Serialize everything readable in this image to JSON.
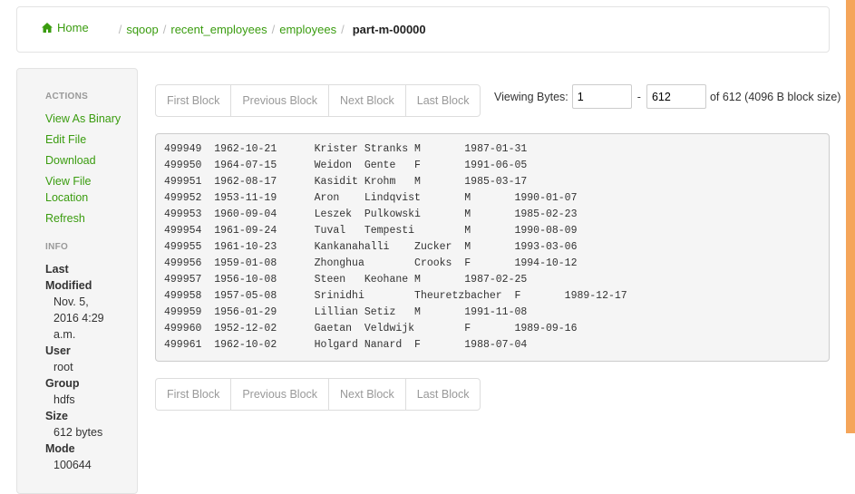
{
  "breadcrumb": {
    "home": "Home",
    "items": [
      "sqoop",
      "recent_employees",
      "employees"
    ],
    "current": "part-m-00000"
  },
  "sidebar": {
    "actions_title": "ACTIONS",
    "actions": [
      "View As Binary",
      "Edit File",
      "Download",
      "View File Location",
      "Refresh"
    ],
    "info_title": "INFO",
    "info": [
      {
        "label": "Last Modified",
        "value": "Nov. 5, 2016 4:29 a.m."
      },
      {
        "label": "User",
        "value": "root"
      },
      {
        "label": "Group",
        "value": "hdfs"
      },
      {
        "label": "Size",
        "value": "612 bytes"
      },
      {
        "label": "Mode",
        "value": "100644"
      }
    ]
  },
  "pager": {
    "first": "First Block",
    "previous": "Previous Block",
    "next": "Next Block",
    "last": "Last Block"
  },
  "viewing": {
    "label": "Viewing Bytes:",
    "start": "1",
    "dash": "-",
    "end": "612",
    "suffix": "of 612 (4096 B block size)"
  },
  "rows": [
    "499949\t1962-10-21\tKrister\tStranks\tM\t1987-01-31",
    "499950\t1964-07-15\tWeidon\tGente\tF\t1991-06-05",
    "499951\t1962-08-17\tKasidit\tKrohm\tM\t1985-03-17",
    "499952\t1953-11-19\tAron\tLindqvist\tM\t1990-01-07",
    "499953\t1960-09-04\tLeszek\tPulkowski\tM\t1985-02-23",
    "499954\t1961-09-24\tTuval\tTempesti\tM\t1990-08-09",
    "499955\t1961-10-23\tKankanahalli\tZucker\tM\t1993-03-06",
    "499956\t1959-01-08\tZhonghua\tCrooks\tF\t1994-10-12",
    "499957\t1956-10-08\tSteen\tKeohane\tM\t1987-02-25",
    "499958\t1957-05-08\tSrinidhi\tTheuretzbacher\tF\t1989-12-17",
    "499959\t1956-01-29\tLillian\tSetiz\tM\t1991-11-08",
    "499960\t1952-12-02\tGaetan\tVeldwijk\tF\t1989-09-16",
    "499961\t1962-10-02\tHolgard\tNanard\tF\t1988-07-04"
  ],
  "colors": {
    "link": "#3a9c0f",
    "scrollbar": "#f5a55a"
  }
}
